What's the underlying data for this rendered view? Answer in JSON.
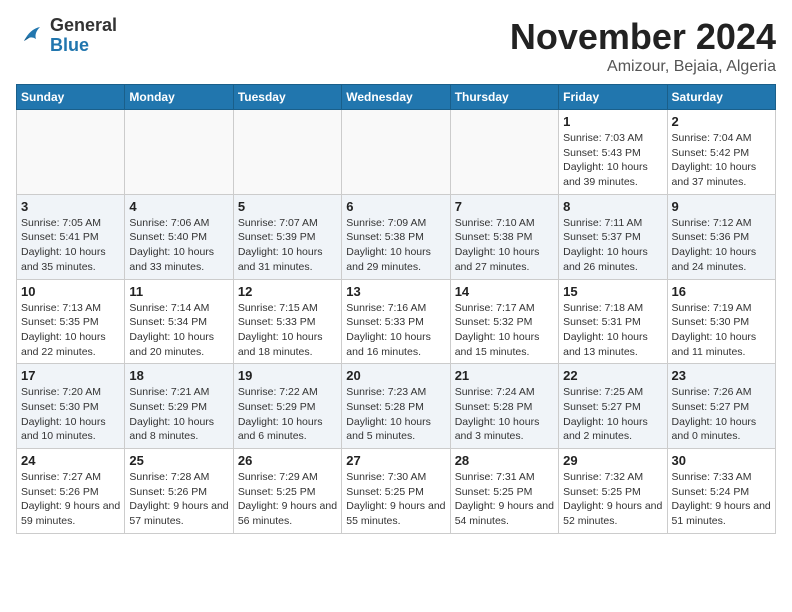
{
  "header": {
    "logo_general": "General",
    "logo_blue": "Blue",
    "month_title": "November 2024",
    "subtitle": "Amizour, Bejaia, Algeria"
  },
  "calendar": {
    "days_of_week": [
      "Sunday",
      "Monday",
      "Tuesday",
      "Wednesday",
      "Thursday",
      "Friday",
      "Saturday"
    ],
    "weeks": [
      [
        {
          "day": "",
          "info": ""
        },
        {
          "day": "",
          "info": ""
        },
        {
          "day": "",
          "info": ""
        },
        {
          "day": "",
          "info": ""
        },
        {
          "day": "",
          "info": ""
        },
        {
          "day": "1",
          "info": "Sunrise: 7:03 AM\nSunset: 5:43 PM\nDaylight: 10 hours and 39 minutes."
        },
        {
          "day": "2",
          "info": "Sunrise: 7:04 AM\nSunset: 5:42 PM\nDaylight: 10 hours and 37 minutes."
        }
      ],
      [
        {
          "day": "3",
          "info": "Sunrise: 7:05 AM\nSunset: 5:41 PM\nDaylight: 10 hours and 35 minutes."
        },
        {
          "day": "4",
          "info": "Sunrise: 7:06 AM\nSunset: 5:40 PM\nDaylight: 10 hours and 33 minutes."
        },
        {
          "day": "5",
          "info": "Sunrise: 7:07 AM\nSunset: 5:39 PM\nDaylight: 10 hours and 31 minutes."
        },
        {
          "day": "6",
          "info": "Sunrise: 7:09 AM\nSunset: 5:38 PM\nDaylight: 10 hours and 29 minutes."
        },
        {
          "day": "7",
          "info": "Sunrise: 7:10 AM\nSunset: 5:38 PM\nDaylight: 10 hours and 27 minutes."
        },
        {
          "day": "8",
          "info": "Sunrise: 7:11 AM\nSunset: 5:37 PM\nDaylight: 10 hours and 26 minutes."
        },
        {
          "day": "9",
          "info": "Sunrise: 7:12 AM\nSunset: 5:36 PM\nDaylight: 10 hours and 24 minutes."
        }
      ],
      [
        {
          "day": "10",
          "info": "Sunrise: 7:13 AM\nSunset: 5:35 PM\nDaylight: 10 hours and 22 minutes."
        },
        {
          "day": "11",
          "info": "Sunrise: 7:14 AM\nSunset: 5:34 PM\nDaylight: 10 hours and 20 minutes."
        },
        {
          "day": "12",
          "info": "Sunrise: 7:15 AM\nSunset: 5:33 PM\nDaylight: 10 hours and 18 minutes."
        },
        {
          "day": "13",
          "info": "Sunrise: 7:16 AM\nSunset: 5:33 PM\nDaylight: 10 hours and 16 minutes."
        },
        {
          "day": "14",
          "info": "Sunrise: 7:17 AM\nSunset: 5:32 PM\nDaylight: 10 hours and 15 minutes."
        },
        {
          "day": "15",
          "info": "Sunrise: 7:18 AM\nSunset: 5:31 PM\nDaylight: 10 hours and 13 minutes."
        },
        {
          "day": "16",
          "info": "Sunrise: 7:19 AM\nSunset: 5:30 PM\nDaylight: 10 hours and 11 minutes."
        }
      ],
      [
        {
          "day": "17",
          "info": "Sunrise: 7:20 AM\nSunset: 5:30 PM\nDaylight: 10 hours and 10 minutes."
        },
        {
          "day": "18",
          "info": "Sunrise: 7:21 AM\nSunset: 5:29 PM\nDaylight: 10 hours and 8 minutes."
        },
        {
          "day": "19",
          "info": "Sunrise: 7:22 AM\nSunset: 5:29 PM\nDaylight: 10 hours and 6 minutes."
        },
        {
          "day": "20",
          "info": "Sunrise: 7:23 AM\nSunset: 5:28 PM\nDaylight: 10 hours and 5 minutes."
        },
        {
          "day": "21",
          "info": "Sunrise: 7:24 AM\nSunset: 5:28 PM\nDaylight: 10 hours and 3 minutes."
        },
        {
          "day": "22",
          "info": "Sunrise: 7:25 AM\nSunset: 5:27 PM\nDaylight: 10 hours and 2 minutes."
        },
        {
          "day": "23",
          "info": "Sunrise: 7:26 AM\nSunset: 5:27 PM\nDaylight: 10 hours and 0 minutes."
        }
      ],
      [
        {
          "day": "24",
          "info": "Sunrise: 7:27 AM\nSunset: 5:26 PM\nDaylight: 9 hours and 59 minutes."
        },
        {
          "day": "25",
          "info": "Sunrise: 7:28 AM\nSunset: 5:26 PM\nDaylight: 9 hours and 57 minutes."
        },
        {
          "day": "26",
          "info": "Sunrise: 7:29 AM\nSunset: 5:25 PM\nDaylight: 9 hours and 56 minutes."
        },
        {
          "day": "27",
          "info": "Sunrise: 7:30 AM\nSunset: 5:25 PM\nDaylight: 9 hours and 55 minutes."
        },
        {
          "day": "28",
          "info": "Sunrise: 7:31 AM\nSunset: 5:25 PM\nDaylight: 9 hours and 54 minutes."
        },
        {
          "day": "29",
          "info": "Sunrise: 7:32 AM\nSunset: 5:25 PM\nDaylight: 9 hours and 52 minutes."
        },
        {
          "day": "30",
          "info": "Sunrise: 7:33 AM\nSunset: 5:24 PM\nDaylight: 9 hours and 51 minutes."
        }
      ]
    ]
  }
}
